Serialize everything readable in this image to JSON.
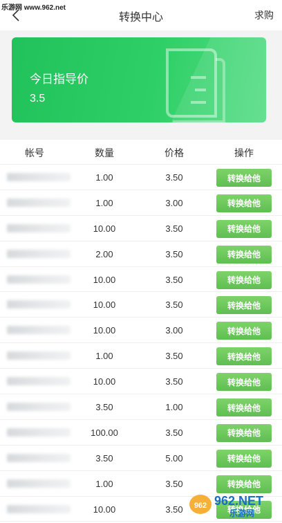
{
  "watermark_top": "乐游网 www.962.net",
  "header": {
    "title": "转换中心",
    "action": "求购"
  },
  "card": {
    "label": "今日指导价",
    "value": "3.5"
  },
  "table": {
    "headers": [
      "帐号",
      "数量",
      "价格",
      "操作"
    ],
    "button_label": "转换给他",
    "rows": [
      {
        "qty": "1.00",
        "price": "3.50"
      },
      {
        "qty": "1.00",
        "price": "3.00"
      },
      {
        "qty": "10.00",
        "price": "3.50"
      },
      {
        "qty": "2.00",
        "price": "3.50"
      },
      {
        "qty": "10.00",
        "price": "3.50"
      },
      {
        "qty": "10.00",
        "price": "3.50"
      },
      {
        "qty": "10.00",
        "price": "3.00"
      },
      {
        "qty": "1.00",
        "price": "3.50"
      },
      {
        "qty": "10.00",
        "price": "3.50"
      },
      {
        "qty": "3.50",
        "price": "1.00"
      },
      {
        "qty": "100.00",
        "price": "3.50"
      },
      {
        "qty": "3.50",
        "price": "5.00"
      },
      {
        "qty": "1.00",
        "price": "3.50"
      },
      {
        "qty": "10.00",
        "price": "3.50"
      }
    ]
  },
  "watermark_bottom": {
    "brand": "962.NET",
    "sub": "乐游网"
  },
  "colors": {
    "card_green": "#2ecf66",
    "button_green": "#6cc85d"
  }
}
